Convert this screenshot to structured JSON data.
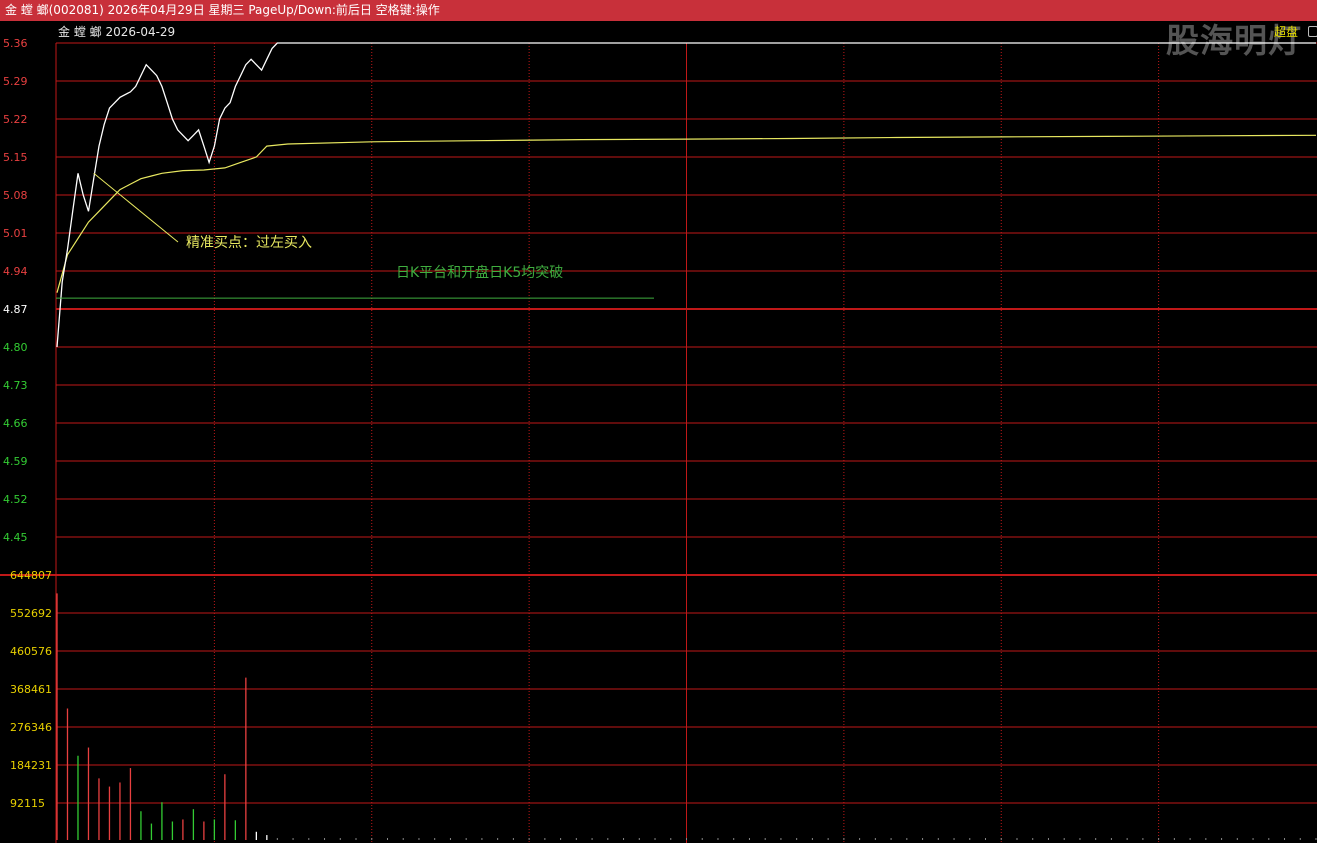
{
  "titlebar": {
    "text": "金 螳 螂(002081) 2026年04月29日 星期三 PageUp/Down:前后日 空格键:操作"
  },
  "header": {
    "stock_label": "金 螳 螂   2026-04-29",
    "super_button": "超盘"
  },
  "watermark": "股海明灯",
  "colors": {
    "up": "#e84040",
    "down": "#33cc33",
    "neutral": "#ffffff",
    "grid": "#c01818",
    "price_line": "#ffffff",
    "avg_line": "#e8e860",
    "annotation_yellow": "#e8e860",
    "annotation_green": "#3fae3f",
    "volume_label": "#e8d000"
  },
  "chart_data": {
    "type": "line",
    "price_axis": {
      "prev_close": 4.87,
      "ticks": [
        "5.36",
        "5.29",
        "5.22",
        "5.15",
        "5.08",
        "5.01",
        "4.94",
        "4.87",
        "4.80",
        "4.73",
        "4.66",
        "4.59",
        "4.52",
        "4.45"
      ],
      "ylim": [
        4.45,
        5.36
      ]
    },
    "volume_axis": {
      "ticks": [
        "644807",
        "552692",
        "460576",
        "368461",
        "276346",
        "184231",
        "92115"
      ],
      "ylim": [
        0,
        644807
      ]
    },
    "x_range": [
      0,
      240
    ],
    "price": [
      [
        0,
        4.8
      ],
      [
        1,
        4.92
      ],
      [
        2,
        4.98
      ],
      [
        3,
        5.05
      ],
      [
        4,
        5.12
      ],
      [
        5,
        5.08
      ],
      [
        6,
        5.05
      ],
      [
        7,
        5.11
      ],
      [
        8,
        5.17
      ],
      [
        9,
        5.21
      ],
      [
        10,
        5.24
      ],
      [
        12,
        5.26
      ],
      [
        14,
        5.27
      ],
      [
        15,
        5.28
      ],
      [
        16,
        5.3
      ],
      [
        17,
        5.32
      ],
      [
        18,
        5.31
      ],
      [
        19,
        5.3
      ],
      [
        20,
        5.28
      ],
      [
        21,
        5.25
      ],
      [
        22,
        5.22
      ],
      [
        23,
        5.2
      ],
      [
        24,
        5.19
      ],
      [
        25,
        5.18
      ],
      [
        26,
        5.19
      ],
      [
        27,
        5.2
      ],
      [
        28,
        5.17
      ],
      [
        29,
        5.14
      ],
      [
        30,
        5.17
      ],
      [
        31,
        5.22
      ],
      [
        32,
        5.24
      ],
      [
        33,
        5.25
      ],
      [
        34,
        5.28
      ],
      [
        35,
        5.3
      ],
      [
        36,
        5.32
      ],
      [
        37,
        5.33
      ],
      [
        38,
        5.32
      ],
      [
        39,
        5.31
      ],
      [
        40,
        5.33
      ],
      [
        41,
        5.35
      ],
      [
        42,
        5.36
      ],
      [
        240,
        5.36
      ]
    ],
    "avg_price": [
      [
        0,
        4.9
      ],
      [
        2,
        4.97
      ],
      [
        4,
        5.0
      ],
      [
        6,
        5.03
      ],
      [
        8,
        5.05
      ],
      [
        10,
        5.07
      ],
      [
        12,
        5.09
      ],
      [
        14,
        5.1
      ],
      [
        16,
        5.11
      ],
      [
        18,
        5.115
      ],
      [
        20,
        5.12
      ],
      [
        24,
        5.125
      ],
      [
        28,
        5.126
      ],
      [
        32,
        5.13
      ],
      [
        35,
        5.14
      ],
      [
        38,
        5.15
      ],
      [
        40,
        5.17
      ],
      [
        44,
        5.174
      ],
      [
        60,
        5.178
      ],
      [
        80,
        5.18
      ],
      [
        100,
        5.182
      ],
      [
        120,
        5.183
      ],
      [
        140,
        5.184
      ],
      [
        160,
        5.186
      ],
      [
        180,
        5.187
      ],
      [
        200,
        5.188
      ],
      [
        220,
        5.189
      ],
      [
        240,
        5.19
      ]
    ],
    "volume": [
      {
        "x": 0,
        "v": 600000,
        "dir": "up"
      },
      {
        "x": 2,
        "v": 320000,
        "dir": "up"
      },
      {
        "x": 4,
        "v": 205000,
        "dir": "down"
      },
      {
        "x": 6,
        "v": 225000,
        "dir": "up"
      },
      {
        "x": 8,
        "v": 150000,
        "dir": "up"
      },
      {
        "x": 10,
        "v": 130000,
        "dir": "up"
      },
      {
        "x": 12,
        "v": 140000,
        "dir": "up"
      },
      {
        "x": 14,
        "v": 175000,
        "dir": "up"
      },
      {
        "x": 16,
        "v": 70000,
        "dir": "down"
      },
      {
        "x": 18,
        "v": 40000,
        "dir": "down"
      },
      {
        "x": 20,
        "v": 92000,
        "dir": "down"
      },
      {
        "x": 22,
        "v": 45000,
        "dir": "down"
      },
      {
        "x": 24,
        "v": 50000,
        "dir": "up"
      },
      {
        "x": 26,
        "v": 75000,
        "dir": "down"
      },
      {
        "x": 28,
        "v": 45000,
        "dir": "up"
      },
      {
        "x": 30,
        "v": 50000,
        "dir": "down"
      },
      {
        "x": 32,
        "v": 160000,
        "dir": "up"
      },
      {
        "x": 34,
        "v": 48000,
        "dir": "down"
      },
      {
        "x": 36,
        "v": 395000,
        "dir": "up"
      },
      {
        "x": 38,
        "v": 20000,
        "dir": "neutral"
      },
      {
        "x": 40,
        "v": 12000,
        "dir": "neutral"
      }
    ],
    "annotations": [
      {
        "text": "精准买点：过左买入",
        "color": "yellow"
      },
      {
        "text": "日K平台和开盘日K5均突破",
        "color": "green"
      }
    ],
    "grid": true
  }
}
